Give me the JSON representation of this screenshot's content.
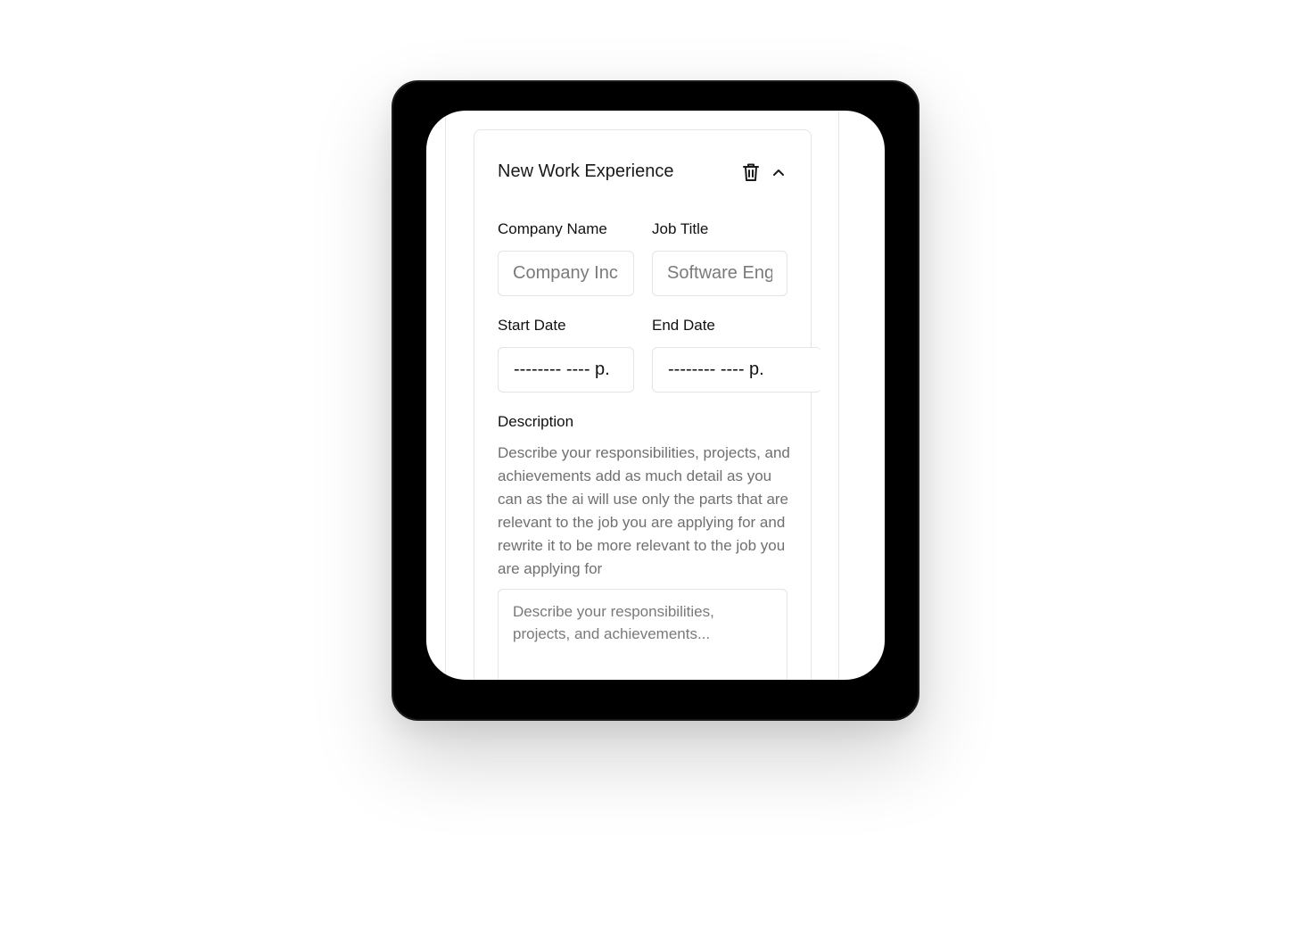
{
  "card": {
    "title": "New Work Experience",
    "delete_icon": "trash-icon",
    "collapse_icon": "chevron-up-icon"
  },
  "fields": {
    "company_name": {
      "label": "Company Name",
      "placeholder": "Company Inc",
      "value": ""
    },
    "job_title": {
      "label": "Job Title",
      "placeholder": "Software Engineer",
      "value": ""
    },
    "start_date": {
      "label": "Start Date",
      "display": "-------- ---- р."
    },
    "end_date": {
      "label": "End Date",
      "display": "-------- ---- р."
    },
    "description": {
      "label": "Description",
      "helper": "Describe your responsibilities, projects, and achievements add as much detail as you can as the ai will use only the parts that are relevant to the job you are applying for and rewrite it to be more relevant to the job you are applying for",
      "placeholder": "Describe your responsibilities, projects, and achievements...",
      "value": ""
    }
  },
  "colors": {
    "device_bezel": "#000000",
    "border": "#e4e4e7",
    "text": "#111111",
    "muted_text": "#707070"
  }
}
